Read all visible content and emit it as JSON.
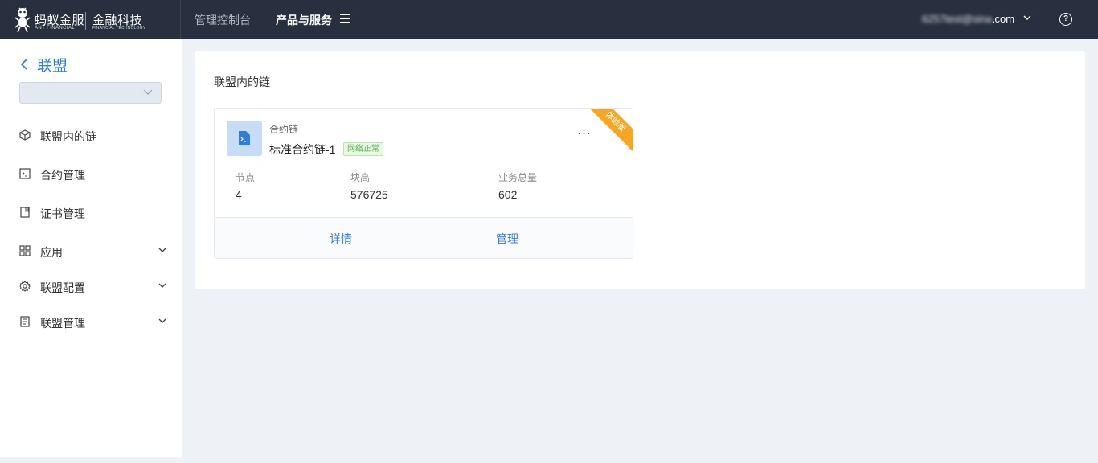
{
  "topbar": {
    "brand_cn": "蚂蚁金服",
    "brand_en": "ANT FINANCIAL",
    "fin_cn": "金融科技",
    "fin_en": "FINANCIAL TECHNOLOGY",
    "nav_console": "管理控制台",
    "nav_products": "产品与服务",
    "user_email_obscured": "6257test@sina",
    "user_email_suffix": ".com",
    "help_glyph": "?",
    "icons": [
      "ant-logo-icon",
      "menu-icon",
      "chevron-down-icon",
      "help-icon"
    ]
  },
  "sidebar": {
    "back_title": "联盟",
    "consortium_select": {
      "value": ""
    },
    "items": [
      {
        "label": "联盟内的链",
        "icon": "cube-icon",
        "expandable": false
      },
      {
        "label": "合约管理",
        "icon": "terminal-icon",
        "expandable": false
      },
      {
        "label": "证书管理",
        "icon": "certificate-icon",
        "expandable": false
      },
      {
        "label": "应用",
        "icon": "grid-icon",
        "expandable": true
      },
      {
        "label": "联盟配置",
        "icon": "gear-icon",
        "expandable": true
      },
      {
        "label": "联盟管理",
        "icon": "list-icon",
        "expandable": true
      }
    ]
  },
  "main": {
    "title": "联盟内的链",
    "chain_card": {
      "type": "合约链",
      "name": "标准合约链-1",
      "status": "网络正常",
      "ribbon": "体验版",
      "more": "···",
      "stats": [
        {
          "label": "节点",
          "value": "4"
        },
        {
          "label": "块高",
          "value": "576725"
        },
        {
          "label": "业务总量",
          "value": "602"
        }
      ],
      "actions": {
        "detail": "详情",
        "manage": "管理"
      }
    }
  },
  "colors": {
    "topbar_bg": "#282f3e",
    "accent": "#2f7fd8",
    "page_bg": "#eef1f6",
    "ribbon": "#f5a623",
    "status_green": "#52b04a"
  }
}
